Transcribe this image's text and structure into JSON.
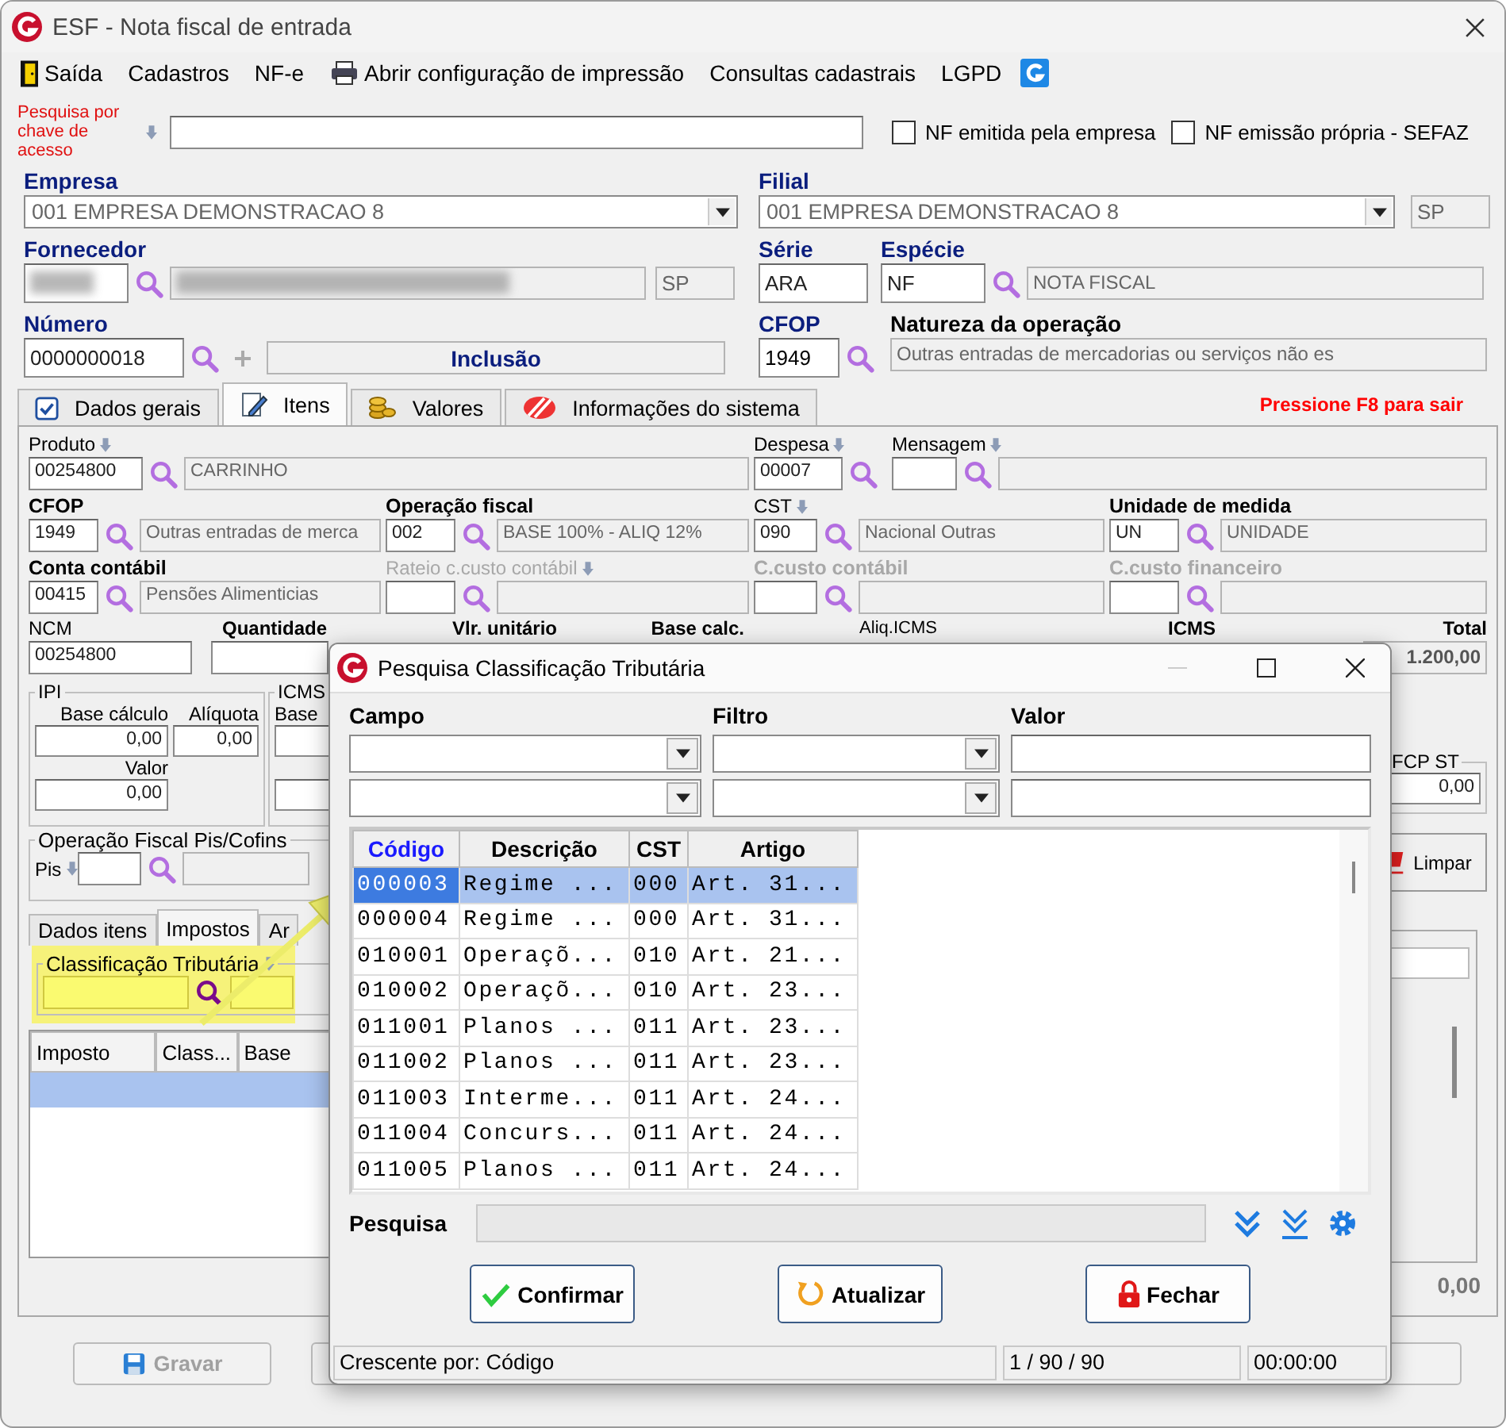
{
  "window": {
    "title": "ESF - Nota fiscal de entrada"
  },
  "menu": [
    "Saída",
    "Cadastros",
    "NF-e",
    "Abrir configuração de impressão",
    "Consultas cadastrais",
    "LGPD"
  ],
  "access_key": {
    "label": "Pesquisa por chave de acesso"
  },
  "checkboxes": [
    {
      "label": "NF emitida pela empresa",
      "checked": false
    },
    {
      "label": "NF emissão própria - SEFAZ",
      "checked": false
    }
  ],
  "empresa": {
    "label": "Empresa",
    "value": "001 EMPRESA DEMONSTRACAO 8"
  },
  "filial": {
    "label": "Filial",
    "value": "001 EMPRESA DEMONSTRACAO 8",
    "uf": "SP"
  },
  "fornecedor": {
    "label": "Fornecedor",
    "uf": "SP",
    "redacted": true
  },
  "serie": {
    "label": "Série",
    "value": "ARA"
  },
  "especie": {
    "label": "Espécie",
    "value": "NF",
    "description": "NOTA FISCAL"
  },
  "numero": {
    "label": "Número",
    "value": "0000000018",
    "status": "Inclusão"
  },
  "cfop": {
    "label": "CFOP",
    "value": "1949"
  },
  "natureza": {
    "label": "Natureza da operação",
    "value": "Outras entradas  de mercadorias ou serviços não es"
  },
  "tabs": [
    {
      "label": "Dados gerais",
      "selected": false
    },
    {
      "label": "Itens",
      "selected": true
    },
    {
      "label": "Valores",
      "selected": false
    },
    {
      "label": "Informações do sistema",
      "selected": false
    }
  ],
  "hint": "Pressione F8 para sair",
  "item_rows": [
    [
      {
        "label": "Produto",
        "kind": "code_desc",
        "arrow": true,
        "bold": false,
        "disabled": false,
        "code": "00254800",
        "description": "CARRINHO"
      },
      {
        "label": "Despesa",
        "kind": "code",
        "arrow": true,
        "bold": false,
        "disabled": false,
        "code": "00007"
      },
      {
        "label": "Mensagem",
        "kind": "code_desc",
        "arrow": true,
        "bold": false,
        "disabled": false
      }
    ],
    [
      {
        "label": "CFOP",
        "kind": "code_desc",
        "arrow": false,
        "bold": true,
        "disabled": false,
        "code": "1949",
        "description": "Outras entradas  de merca"
      },
      {
        "label": "Operação fiscal",
        "kind": "code_desc",
        "arrow": false,
        "bold": true,
        "disabled": false,
        "code": "002",
        "description": "BASE 100% - ALIQ 12%"
      },
      {
        "label": "CST",
        "kind": "code_desc",
        "arrow": true,
        "bold": false,
        "disabled": false,
        "code": "090",
        "description": "Nacional Outras"
      },
      {
        "label": "Unidade de medida",
        "kind": "code_desc",
        "arrow": false,
        "bold": true,
        "disabled": false,
        "code": "UN",
        "description": "UNIDADE"
      }
    ],
    [
      {
        "label": "Conta contábil",
        "kind": "code_desc",
        "arrow": false,
        "bold": true,
        "disabled": false,
        "code": "00415",
        "description": "Pensões Alimenticias"
      },
      {
        "label": "Rateio c.custo contábil",
        "kind": "code_desc",
        "arrow": true,
        "bold": false,
        "disabled": true
      },
      {
        "label": "C.custo contábil",
        "kind": "code_desc",
        "arrow": false,
        "bold": true,
        "disabled": true
      },
      {
        "label": "C.custo financeiro",
        "kind": "code_desc",
        "arrow": false,
        "bold": true,
        "disabled": true
      }
    ]
  ],
  "item_totals": {
    "labels": [
      "NCM",
      "Quantidade",
      "Vlr. unitário",
      "Base calc.",
      "Aliq.ICMS",
      "ICMS",
      "Total"
    ],
    "ncm": "00254800",
    "total": "1.200,00"
  },
  "ipi": {
    "legend": "IPI",
    "base_label": "Base cálculo",
    "base": "0,00",
    "aliquota_label": "Alíquota",
    "aliquota": "0,00",
    "valor_label": "Valor",
    "valor": "0,00"
  },
  "icms": {
    "legend": "ICMS",
    "base_label": "Base"
  },
  "pis_cofins": {
    "legend": "Operação Fiscal Pis/Cofins",
    "pis_label": "Pis"
  },
  "sub_tabs": [
    {
      "label": "Dados itens",
      "selected": false
    },
    {
      "label": "Impostos",
      "selected": true
    },
    {
      "label": "Ar",
      "selected": false
    }
  ],
  "classificacao": {
    "legend": "Classificação Tributária",
    "highlighted": true
  },
  "tax_table": {
    "columns": [
      "Imposto",
      "Class...",
      "Base"
    ],
    "rows": [
      {
        "selected": true
      }
    ]
  },
  "fcp_st": {
    "legend": "FCP ST",
    "value": "0,00"
  },
  "clear_button": "Limpar",
  "footer_total": "0,00",
  "bottom_buttons": [
    {
      "label": "Gravar",
      "disabled": true
    }
  ],
  "dialog": {
    "title": "Pesquisa Classificação Tributária",
    "filter_labels": [
      "Campo",
      "Filtro",
      "Valor"
    ],
    "columns": [
      {
        "label": "Código",
        "sorted": true
      },
      {
        "label": "Descrição",
        "sorted": false
      },
      {
        "label": "CST",
        "sorted": false
      },
      {
        "label": "Artigo",
        "sorted": false
      }
    ],
    "rows": [
      {
        "cells": [
          "000003",
          "Regime ...",
          "000",
          "Art. 31..."
        ],
        "selected": true
      },
      {
        "cells": [
          "000004",
          "Regime ...",
          "000",
          "Art. 31..."
        ],
        "selected": false
      },
      {
        "cells": [
          "010001",
          "Operaçõ...",
          "010",
          "Art. 21..."
        ],
        "selected": false
      },
      {
        "cells": [
          "010002",
          "Operaçõ...",
          "010",
          "Art. 23..."
        ],
        "selected": false
      },
      {
        "cells": [
          "011001",
          "Planos ...",
          "011",
          "Art. 23..."
        ],
        "selected": false
      },
      {
        "cells": [
          "011002",
          "Planos ...",
          "011",
          "Art. 23..."
        ],
        "selected": false
      },
      {
        "cells": [
          "011003",
          "Interme...",
          "011",
          "Art. 24..."
        ],
        "selected": false
      },
      {
        "cells": [
          "011004",
          "Concurs...",
          "011",
          "Art. 24..."
        ],
        "selected": false
      },
      {
        "cells": [
          "011005",
          "Planos ...",
          "011",
          "Art. 24..."
        ],
        "selected": false
      }
    ],
    "search_label": "Pesquisa",
    "buttons": [
      "Confirmar",
      "Atualizar",
      "Fechar"
    ],
    "status": [
      "Crescente por: Código",
      "1 / 90 / 90",
      "00:00:00"
    ]
  }
}
